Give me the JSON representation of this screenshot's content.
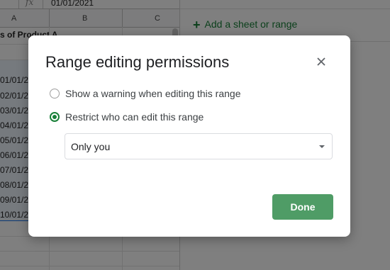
{
  "sheet": {
    "cell_value": "01/01/2021",
    "formula_icon": "fx",
    "columns": [
      "A",
      "B",
      "C"
    ],
    "title_text": "s of Product A",
    "dates": [
      "01/01/2",
      "02/01/2",
      "03/01/2",
      "04/01/2",
      "05/01/2",
      "06/01/2",
      "07/01/2",
      "08/01/2",
      "09/01/2",
      "10/01/2"
    ]
  },
  "side_panel": {
    "add_range_label": "Add a sheet or range"
  },
  "dialog": {
    "title": "Range editing permissions",
    "option_warning": "Show a warning when editing this range",
    "option_restrict": "Restrict who can edit this range",
    "restrict_selected": "Only you",
    "done_label": "Done",
    "accent_color": "#188038"
  }
}
